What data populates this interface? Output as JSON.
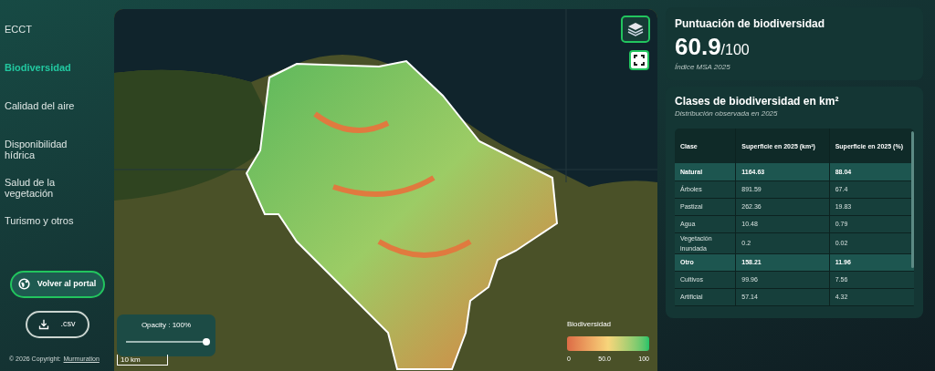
{
  "sidebar": {
    "items": [
      {
        "label": "ECCT",
        "selected": false
      },
      {
        "label": "Biodiversidad",
        "selected": true
      },
      {
        "label": "Calidad del aire",
        "selected": false
      },
      {
        "label": "Disponibilidad hídrica",
        "selected": false
      },
      {
        "label": "Salud de la vegetación",
        "selected": false
      },
      {
        "label": "Turismo y otros",
        "selected": false
      }
    ],
    "portal_button": "Volver al portal",
    "csv_button": ".csv",
    "copyright": "© 2026 Copyright:",
    "copyright_link": "Murmuration"
  },
  "map": {
    "opacity": {
      "label": "Opacity : 100%",
      "level": 1
    },
    "scale": "10 km",
    "legend": {
      "title": "Biodiversidad",
      "ticks": [
        "0",
        "50.0",
        "100"
      ]
    }
  },
  "score": {
    "title": "Puntuación de biodiversidad",
    "value": "60.9",
    "max": "/100",
    "caption": "Índice MSA 2025"
  },
  "classes": {
    "title": "Clases de biodiversidad en km²",
    "subtitle": "Distribución observada en 2025",
    "table": {
      "columns": [
        "Clase",
        "Superficie en 2025 (km²)",
        "Superficie en 2025 (%)"
      ],
      "rows": [
        {
          "kind": "group",
          "cells": [
            "Natural",
            "1164.63",
            "88.04"
          ]
        },
        {
          "kind": "item",
          "cells": [
            "Árboles",
            "891.59",
            "67.4"
          ]
        },
        {
          "kind": "item",
          "cells": [
            "Pastizal",
            "262.36",
            "19.83"
          ]
        },
        {
          "kind": "item",
          "cells": [
            "Agua",
            "10.48",
            "0.79"
          ]
        },
        {
          "kind": "item",
          "cells": [
            "Vegetación inundada",
            "0.2",
            "0.02"
          ]
        },
        {
          "kind": "group",
          "cells": [
            "Otro",
            "158.21",
            "11.96"
          ]
        },
        {
          "kind": "item",
          "cells": [
            "Cultivos",
            "99.96",
            "7.56"
          ]
        },
        {
          "kind": "item",
          "cells": [
            "Artificial",
            "57.14",
            "4.32"
          ]
        }
      ]
    }
  }
}
